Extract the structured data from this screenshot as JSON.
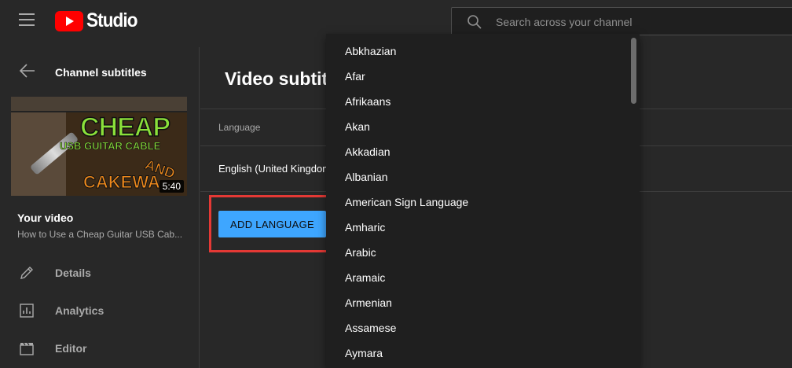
{
  "header": {
    "logo_text": "Studio",
    "search_placeholder": "Search across your channel"
  },
  "sidebar": {
    "title": "Channel subtitles",
    "thumbnail": {
      "duration": "5:40",
      "line1": "CHEAP",
      "line2": "USB GUITAR CABLE",
      "line3": "CAKEWA",
      "line4": "AND"
    },
    "your_video_label": "Your video",
    "video_title": "How to Use a Cheap Guitar USB Cab...",
    "nav": [
      {
        "label": "Details",
        "icon": "pencil-icon"
      },
      {
        "label": "Analytics",
        "icon": "analytics-icon"
      },
      {
        "label": "Editor",
        "icon": "clapperboard-icon"
      }
    ]
  },
  "main": {
    "title": "Video subtitles",
    "table": {
      "header_language": "Language",
      "rows": [
        {
          "language": "English (United Kingdom)"
        }
      ]
    },
    "add_language_label": "ADD LANGUAGE"
  },
  "dropdown": {
    "items": [
      "Abkhazian",
      "Afar",
      "Afrikaans",
      "Akan",
      "Akkadian",
      "Albanian",
      "American Sign Language",
      "Amharic",
      "Arabic",
      "Aramaic",
      "Armenian",
      "Assamese",
      "Aymara"
    ]
  },
  "colors": {
    "accent_blue": "#3ea6ff",
    "highlight_red": "#e53935",
    "youtube_red": "#ff0000"
  }
}
